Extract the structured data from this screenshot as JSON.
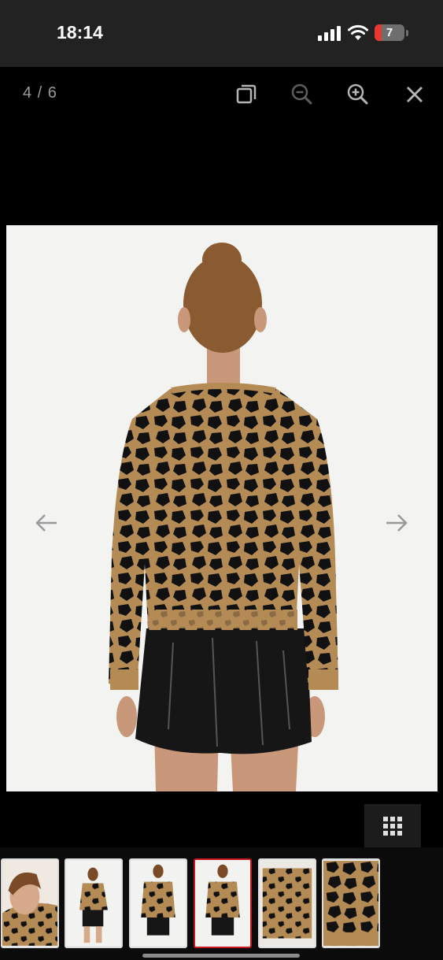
{
  "status_bar": {
    "time": "18:14",
    "battery_level": "7",
    "battery_color": "#e8372e"
  },
  "viewer": {
    "counter": "4 / 6",
    "current_index": 4,
    "total": 6,
    "tools": [
      "fullscreen-icon",
      "zoom-out-icon",
      "zoom-in-icon",
      "close-icon"
    ]
  },
  "colors": {
    "leopard_base": "#b48a55",
    "leopard_spot": "#111111",
    "active_thumb_border": "#c8161e"
  },
  "thumbnails": [
    {
      "view": "face-closeup"
    },
    {
      "view": "full-body-front"
    },
    {
      "view": "front-three-quarter"
    },
    {
      "view": "back-view",
      "active": true
    },
    {
      "view": "fabric-flat"
    },
    {
      "view": "fabric-detail"
    }
  ]
}
